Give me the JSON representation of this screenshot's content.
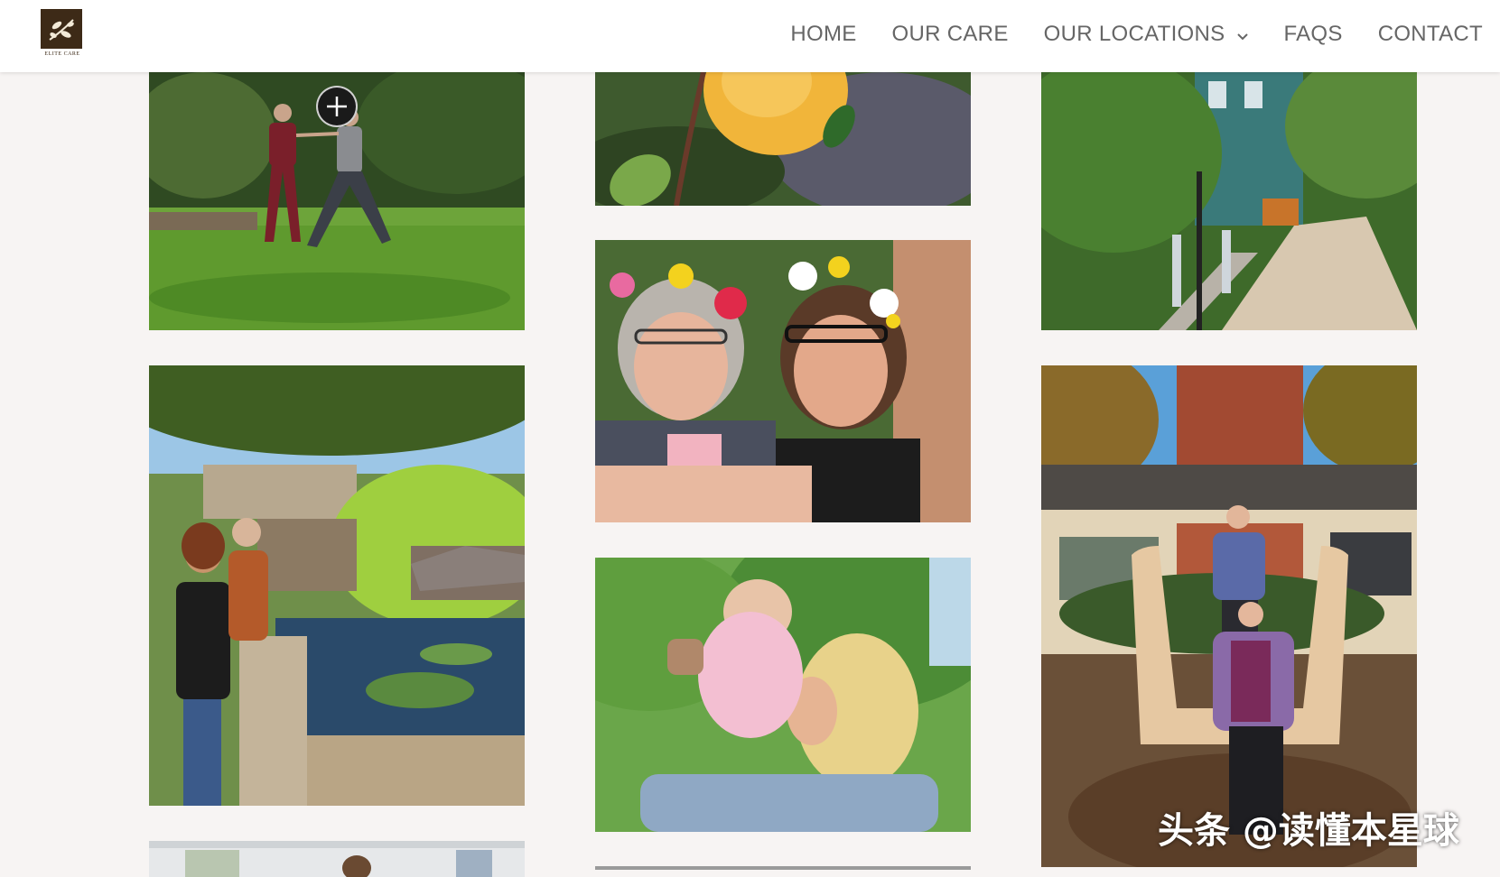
{
  "header": {
    "logo": {
      "name": "ELITE CARE",
      "icon": "branch-leaves-logo",
      "color": "#3d2a17"
    },
    "nav": [
      {
        "label": "HOME"
      },
      {
        "label": "OUR CARE"
      },
      {
        "label": "OUR LOCATIONS",
        "has_dropdown": true
      },
      {
        "label": "FAQS"
      },
      {
        "label": "CONTACT"
      }
    ]
  },
  "gallery": {
    "images": [
      {
        "name": "tai-chi-lawn-photo"
      },
      {
        "name": "peach-branch-photo"
      },
      {
        "name": "garden-walkway-photo"
      },
      {
        "name": "pond-deck-photo"
      },
      {
        "name": "flower-crown-selfie-photo"
      },
      {
        "name": "grandmother-baby-photo"
      },
      {
        "name": "stump-chair-couple-photo"
      },
      {
        "name": "tent-event-photo"
      }
    ],
    "zoom_icon": "plus-zoom-icon"
  },
  "watermark": "头条 @读懂本星球"
}
